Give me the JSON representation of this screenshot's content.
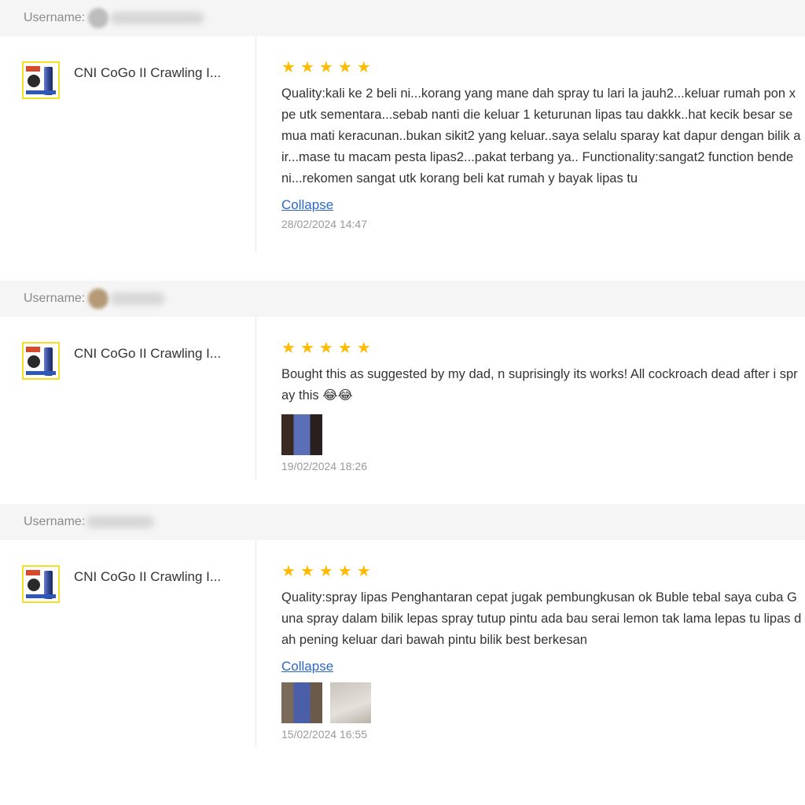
{
  "reviews": [
    {
      "username_label": "Username:",
      "product_name": "CNI CoGo II Crawling I...",
      "rating": 5,
      "text": "Quality:kali ke 2 beli ni...korang yang mane dah spray tu lari la jauh2...keluar rumah pon x pe utk sementara...sebab nanti die keluar 1 keturunan lipas tau dakkk..hat kecik besar semua mati keracunan..bukan sikit2 yang keluar..saya selalu sparay kat dapur dengan bilik air...mase tu macam pesta lipas2...pakat terbang ya.. Functionality:sangat2 function bende ni...rekomen sangat utk korang beli kat rumah y bayak lipas tu",
      "collapse_label": "Collapse",
      "date": "28/02/2024 14:47"
    },
    {
      "username_label": "Username:",
      "product_name": "CNI CoGo II Crawling I...",
      "rating": 5,
      "text": "Bought this as suggested by my dad, n suprisingly its works! All cockroach dead after i spray this 😂😂",
      "date": "19/02/2024 18:26"
    },
    {
      "username_label": "Username:",
      "product_name": "CNI CoGo II Crawling I...",
      "rating": 5,
      "text": "Quality:spray lipas Penghantaran cepat jugak pembungkusan ok Buble tebal saya cuba Guna spray dalam bilik lepas spray tutup pintu ada bau serai lemon tak lama lepas tu lipas dah pening keluar dari bawah pintu bilik best berkesan",
      "collapse_label": "Collapse",
      "date": "15/02/2024 16:55"
    }
  ],
  "colors": {
    "star": "#ffbb00",
    "link": "#2c67c7",
    "user_bar_bg": "#f5f5f5",
    "thumb_border": "#f2df26"
  },
  "icons": {
    "star": "★"
  }
}
